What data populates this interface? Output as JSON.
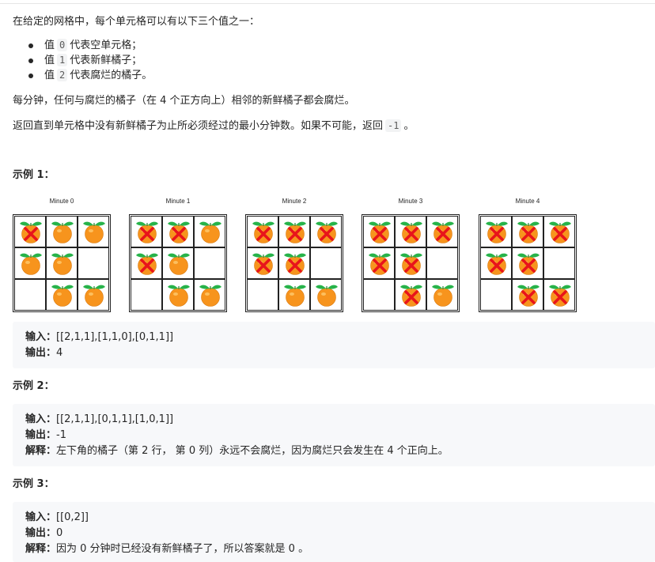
{
  "intro": "在给定的网格中，每个单元格可以有以下三个值之一：",
  "bullets": [
    {
      "pre": "值",
      "code": "0",
      "post": "代表空单元格；"
    },
    {
      "pre": "值",
      "code": "1",
      "post": "代表新鲜橘子；"
    },
    {
      "pre": "值",
      "code": "2",
      "post": "代表腐烂的橘子。"
    }
  ],
  "para_rule": "每分钟，任何与腐烂的橘子（在 4 个正方向上）相邻的新鲜橘子都会腐烂。",
  "para_return_pre": "返回直到单元格中没有新鲜橘子为止所必须经过的最小分钟数。如果不可能，返回",
  "para_return_code": "-1",
  "para_return_post": "。",
  "colors": {
    "orange": "#f7941d",
    "leaf": "#27b34a",
    "cross": "#e8141b",
    "code_bg": "#f2f3f4",
    "pre_bg": "#f7f8fa"
  },
  "examples": [
    {
      "heading": "示例 1：",
      "figures": [
        {
          "title": "Minute 0",
          "grid": [
            [
              2,
              1,
              1
            ],
            [
              1,
              1,
              0
            ],
            [
              0,
              1,
              1
            ]
          ]
        },
        {
          "title": "Minute 1",
          "grid": [
            [
              2,
              2,
              1
            ],
            [
              2,
              1,
              0
            ],
            [
              0,
              1,
              1
            ]
          ]
        },
        {
          "title": "Minute 2",
          "grid": [
            [
              2,
              2,
              2
            ],
            [
              2,
              2,
              0
            ],
            [
              0,
              1,
              1
            ]
          ]
        },
        {
          "title": "Minute 3",
          "grid": [
            [
              2,
              2,
              2
            ],
            [
              2,
              2,
              0
            ],
            [
              0,
              2,
              1
            ]
          ]
        },
        {
          "title": "Minute 4",
          "grid": [
            [
              2,
              2,
              2
            ],
            [
              2,
              2,
              0
            ],
            [
              0,
              2,
              2
            ]
          ]
        }
      ],
      "input_label": "输入：",
      "input": "[[2,1,1],[1,1,0],[0,1,1]]",
      "output_label": "输出：",
      "output": "4"
    },
    {
      "heading": "示例 2：",
      "input_label": "输入：",
      "input": "[[2,1,1],[0,1,1],[1,0,1]]",
      "output_label": "输出：",
      "output": "-1",
      "explain_label": "解释：",
      "explain": "左下角的橘子（第 2 行， 第 0 列）永远不会腐烂，因为腐烂只会发生在 4 个正向上。"
    },
    {
      "heading": "示例 3：",
      "input_label": "输入：",
      "input": "[[0,2]]",
      "output_label": "输出：",
      "output": "0",
      "explain_label": "解释：",
      "explain": "因为 0 分钟时已经没有新鲜橘子了，所以答案就是 0 。"
    }
  ]
}
